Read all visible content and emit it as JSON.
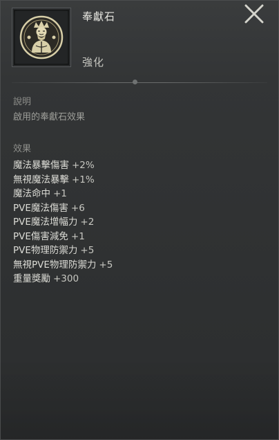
{
  "item": {
    "name": "奉獻石",
    "grade": "強化",
    "icon": "deity-idol-icon"
  },
  "description": {
    "title": "說明",
    "text": "啟用的奉獻石效果"
  },
  "effects": {
    "title": "效果",
    "list": [
      {
        "label": "魔法暴擊傷害",
        "value": "+2%"
      },
      {
        "label": "無視魔法暴擊",
        "value": "+1%"
      },
      {
        "label": "魔法命中",
        "value": "+1"
      },
      {
        "label": "PVE魔法傷害",
        "value": "+6"
      },
      {
        "label": "PVE魔法增幅力",
        "value": "+2"
      },
      {
        "label": "PVE傷害減免",
        "value": "+1"
      },
      {
        "label": "PVE物理防禦力",
        "value": "+5"
      },
      {
        "label": "無視PVE物理防禦力",
        "value": "+5"
      },
      {
        "label": "重量獎勵",
        "value": "+300"
      }
    ]
  },
  "colors": {
    "panel_bg": "#333536",
    "text_primary": "#dcdcd6",
    "text_muted": "#8d8e8a",
    "icon_gold": "#d8cfa8"
  }
}
